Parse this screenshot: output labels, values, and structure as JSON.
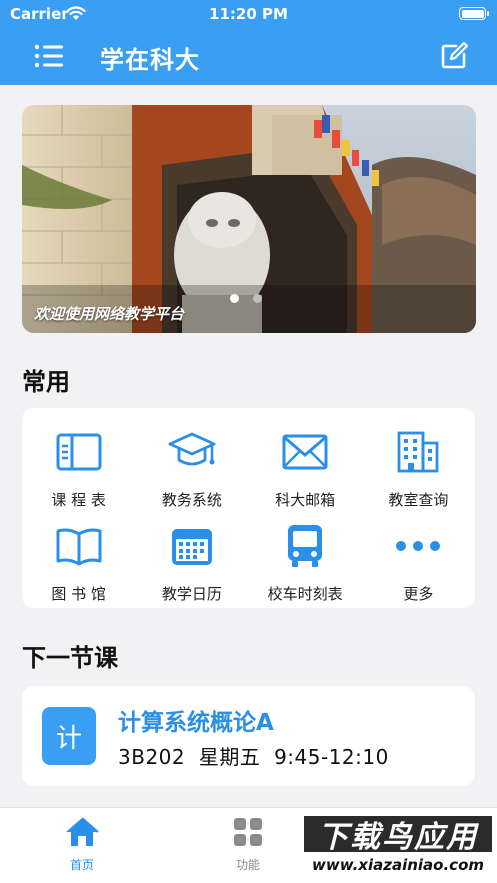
{
  "status_bar": {
    "carrier": "Carrier",
    "time": "11:20 PM"
  },
  "nav": {
    "title": "学在科大",
    "menu_icon": "menu-icon",
    "edit_icon": "edit-icon"
  },
  "banner": {
    "caption": "欢迎使用网络教学平台",
    "page_count": 2,
    "active_page": 1
  },
  "common": {
    "title": "常用",
    "items": [
      {
        "label": "课 程 表",
        "icon": "schedule-icon"
      },
      {
        "label": "教务系统",
        "icon": "graduation-cap-icon"
      },
      {
        "label": "科大邮箱",
        "icon": "mail-icon"
      },
      {
        "label": "教室查询",
        "icon": "building-icon"
      },
      {
        "label": "图 书 馆",
        "icon": "book-icon"
      },
      {
        "label": "教学日历",
        "icon": "calendar-icon"
      },
      {
        "label": "校车时刻表",
        "icon": "bus-icon"
      },
      {
        "label": "更多",
        "icon": "more-icon"
      }
    ]
  },
  "next_class": {
    "title": "下一节课",
    "badge": "计",
    "course_name": "计算系统概论A",
    "room": "3B202",
    "day": "星期五",
    "time": "9:45-12:10"
  },
  "tabbar": {
    "tabs": [
      {
        "label": "首页",
        "icon": "home-icon",
        "active": true
      },
      {
        "label": "功能",
        "icon": "grid-icon",
        "active": false
      }
    ]
  },
  "watermark": {
    "top_text": "下载鸟应用",
    "bottom_text": "www.xiazainiao.com"
  },
  "colors": {
    "primary": "#3a9ff3",
    "accent_text": "#2a8fe8",
    "background": "#f2f2f4"
  }
}
